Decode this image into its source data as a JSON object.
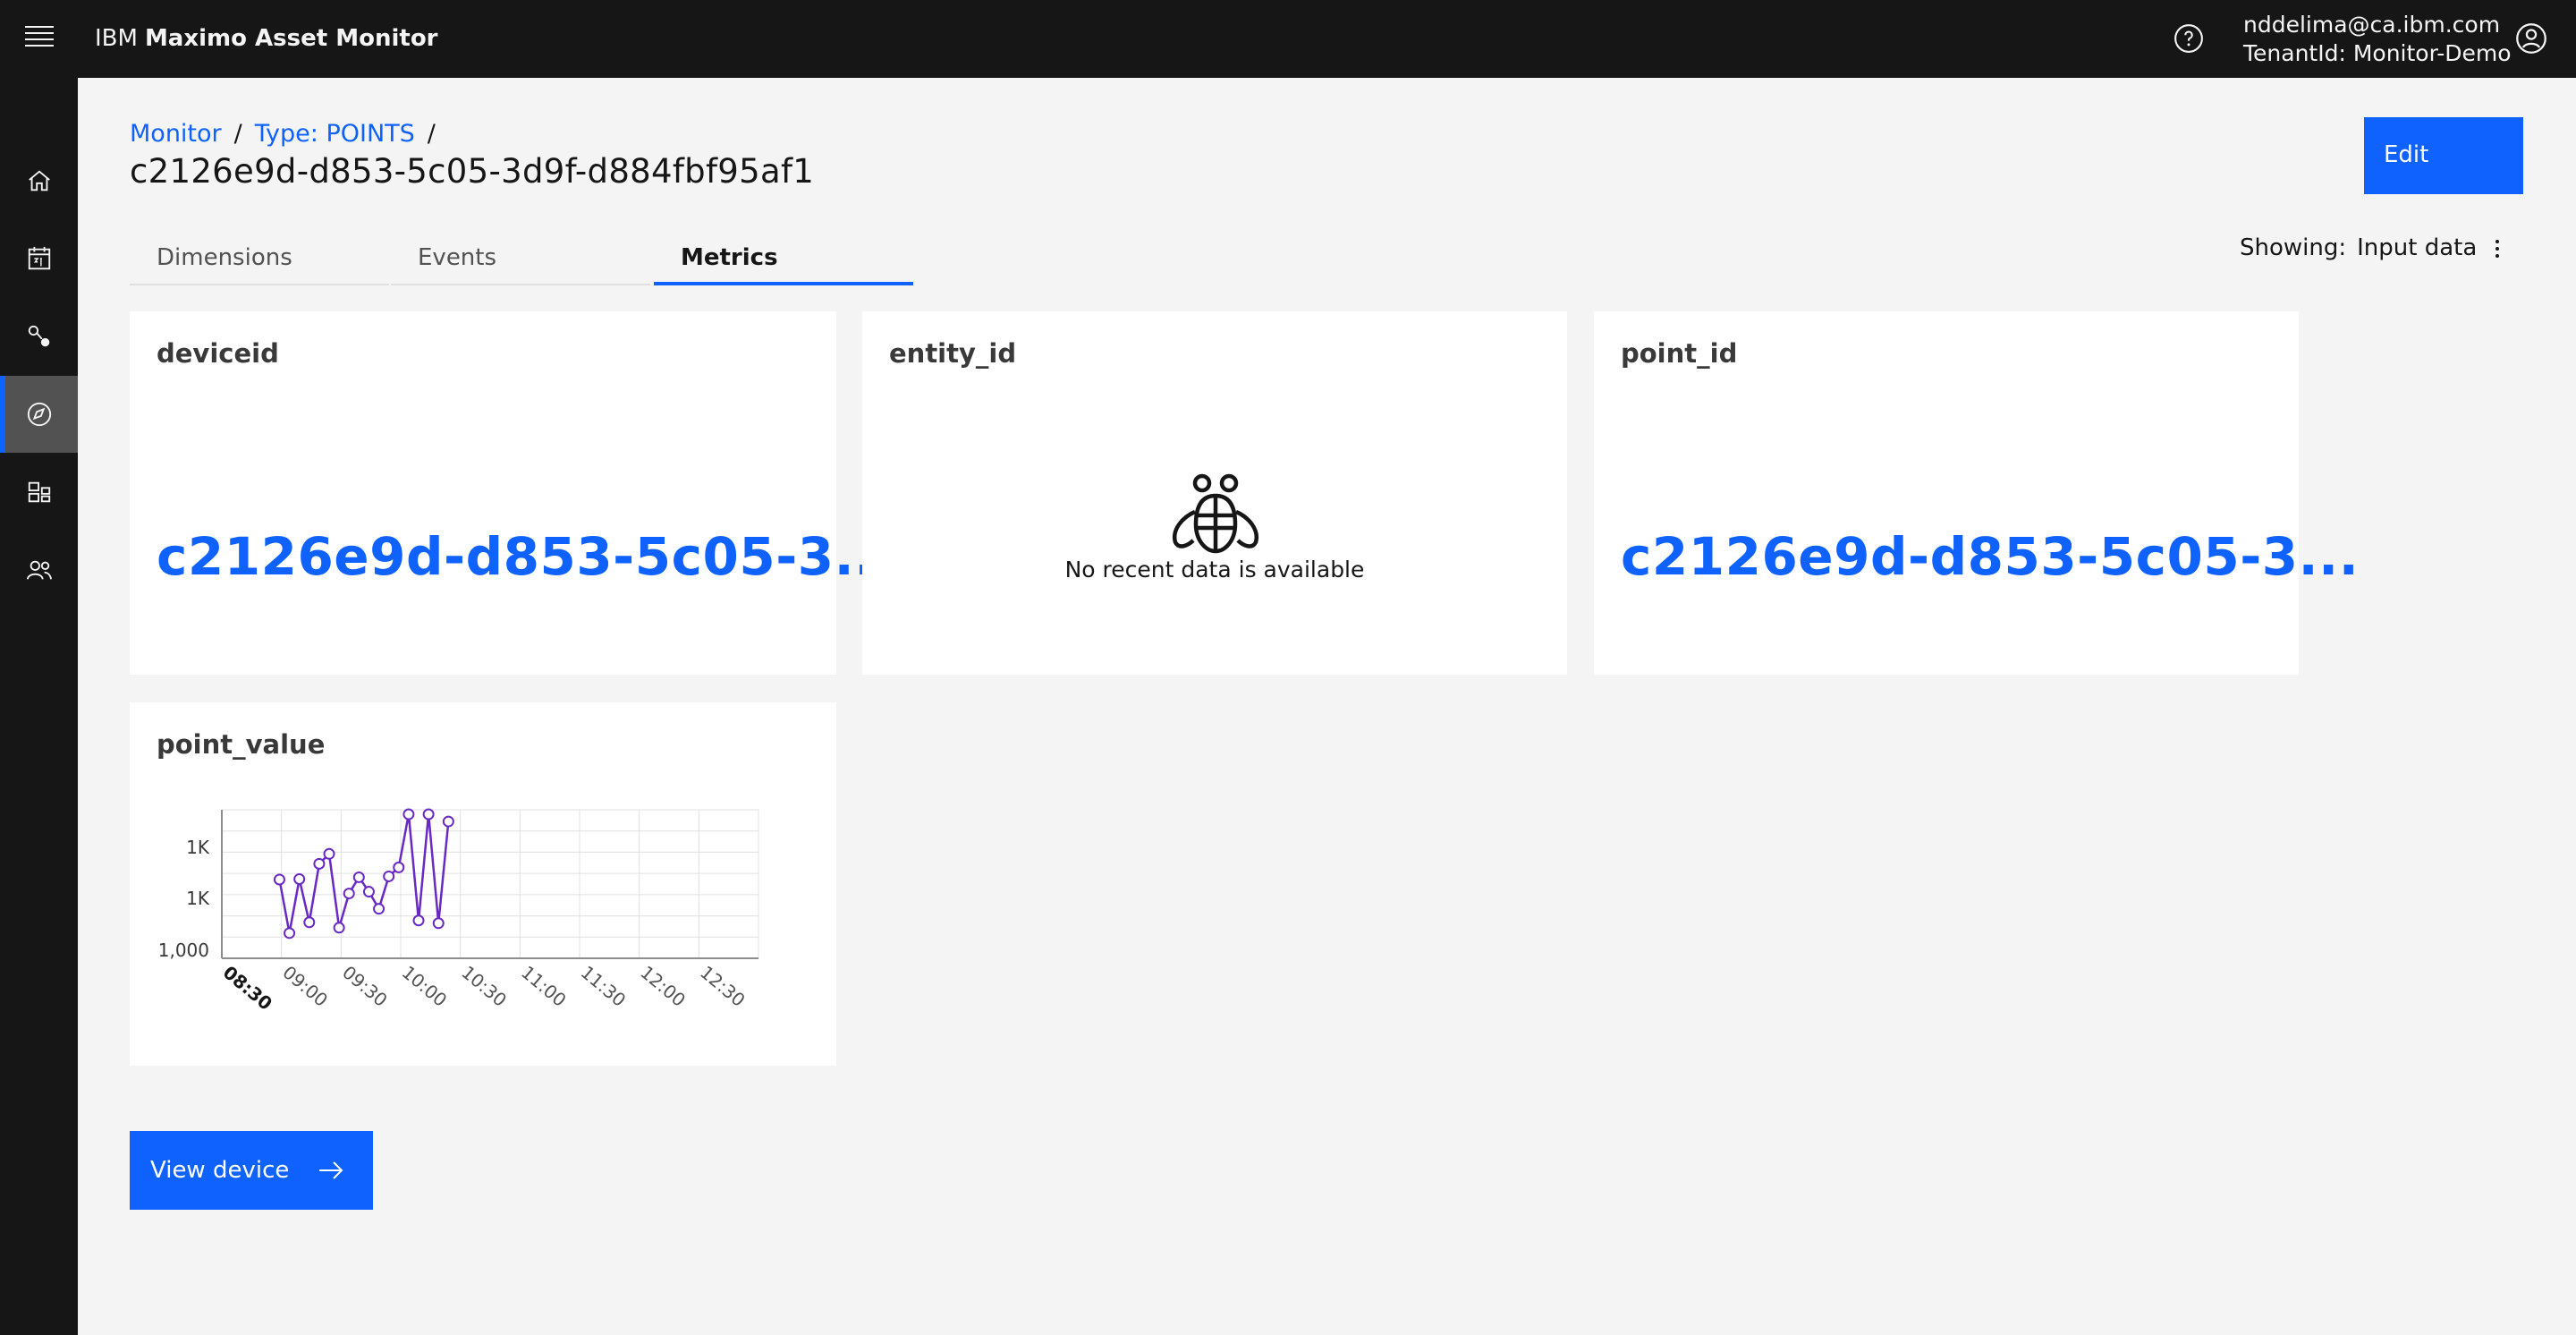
{
  "header": {
    "brand_prefix": "IBM",
    "product_name": "Maximo Asset Monitor",
    "user_email": "nddelima@ca.ibm.com",
    "tenant": "TenantId: Monitor-Demo"
  },
  "sidenav": {
    "items": [
      {
        "icon": "home-icon",
        "active": false
      },
      {
        "icon": "calendar-icon",
        "active": false
      },
      {
        "icon": "connection-icon",
        "active": false
      },
      {
        "icon": "compass-icon",
        "active": true
      },
      {
        "icon": "dashboard-icon",
        "active": false
      },
      {
        "icon": "user-admin-icon",
        "active": false
      }
    ]
  },
  "breadcrumb": {
    "items": [
      "Monitor",
      "Type: POINTS"
    ],
    "separator": "/"
  },
  "page": {
    "title": "c2126e9d-d853-5c05-3d9f-d884fbf95af1",
    "edit_label": "Edit"
  },
  "tabs": [
    {
      "label": "Dimensions",
      "active": false
    },
    {
      "label": "Events",
      "active": false
    },
    {
      "label": "Metrics",
      "active": true
    }
  ],
  "showing": {
    "label": "Showing:",
    "value": "Input data"
  },
  "cards": {
    "deviceid": {
      "title": "deviceid",
      "value": "c2126e9d-d853-5c05-3..."
    },
    "entity_id": {
      "title": "entity_id",
      "empty_text": "No recent data is available"
    },
    "point_id": {
      "title": "point_id",
      "value": "c2126e9d-d853-5c05-3..."
    },
    "point_value": {
      "title": "point_value"
    }
  },
  "view_device_label": "View device",
  "colors": {
    "primary": "#0f62fe",
    "header_bg": "#161616",
    "series": "#6929c4"
  },
  "chart_data": {
    "type": "line",
    "title": "",
    "ytick_labels": [
      "1,000",
      "1K",
      "1K"
    ],
    "xtick_labels": [
      "08:30",
      "09:00",
      "09:30",
      "10:00",
      "10:30",
      "11:00",
      "11:30",
      "12:00",
      "12:30"
    ],
    "xlabel": "",
    "ylabel": "",
    "series": [
      {
        "x": [
          "08:59",
          "09:04",
          "09:09",
          "09:14",
          "09:19",
          "09:24",
          "09:29",
          "09:34",
          "09:39",
          "09:44",
          "09:49",
          "09:54",
          "09:59",
          "10:04",
          "10:09",
          "10:14",
          "10:19",
          "10:24",
          "10:29",
          "10:34",
          "10:39"
        ],
        "values": [
          1001.55,
          1000.36,
          1001.56,
          1000.6,
          1001.9,
          1002.12,
          1000.48,
          1001.24,
          1001.6,
          1001.28,
          1000.9,
          1001.62,
          1001.82,
          1003.0,
          1000.64,
          1003.0,
          1000.58,
          1002.84,
          null,
          null,
          null
        ]
      }
    ],
    "legend": "none",
    "grid": true
  }
}
